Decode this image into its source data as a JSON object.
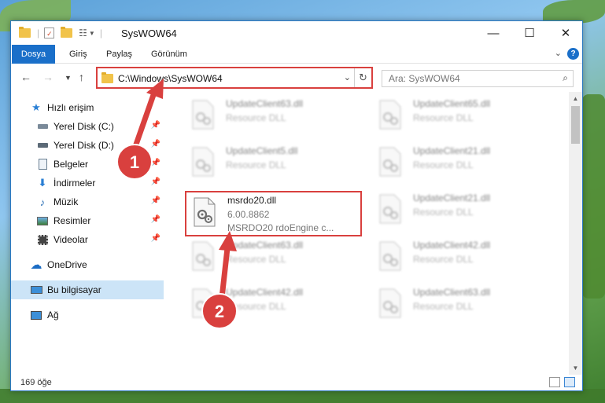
{
  "window": {
    "title": "SysWOW64"
  },
  "ribbon": {
    "tabs": [
      "Dosya",
      "Giriş",
      "Paylaş",
      "Görünüm"
    ],
    "help": "?"
  },
  "nav": {
    "address_path": "C:\\Windows\\SysWOW64",
    "search_placeholder": "Ara: SysWOW64"
  },
  "sidebar": {
    "items": [
      {
        "label": "Hızlı erişim",
        "icon": "star-icon"
      },
      {
        "label": "Yerel Disk (C:)",
        "icon": "drive-icon",
        "pinned": true
      },
      {
        "label": "Yerel Disk (D:)",
        "icon": "drive-icon",
        "pinned": true
      },
      {
        "label": "Belgeler",
        "icon": "documents-icon",
        "pinned": true
      },
      {
        "label": "İndirmeler",
        "icon": "download-icon",
        "pinned": true
      },
      {
        "label": "Müzik",
        "icon": "music-icon",
        "pinned": true
      },
      {
        "label": "Resimler",
        "icon": "pictures-icon",
        "pinned": true
      },
      {
        "label": "Videolar",
        "icon": "videos-icon",
        "pinned": true
      },
      {
        "label": "OneDrive",
        "icon": "onedrive-icon"
      },
      {
        "label": "Bu bilgisayar",
        "icon": "computer-icon",
        "selected": true
      },
      {
        "label": "Ağ",
        "icon": "network-icon"
      }
    ]
  },
  "files": {
    "blurred": [
      {
        "name": "UpdateClient63.dll",
        "type": "Resource DLL"
      },
      {
        "name": "UpdateClient65.dll",
        "type": "Resource DLL"
      },
      {
        "name": "UpdateClient5.dll",
        "type": "Resource DLL"
      },
      {
        "name": "UpdateClient21.dll",
        "type": "Resource DLL"
      },
      {
        "name": "UpdateClient21.dll",
        "type": "Resource DLL"
      },
      {
        "name": "UpdateClient63.dll",
        "type": "Resource DLL"
      },
      {
        "name": "UpdateClient42.dll",
        "type": "Resource DLL"
      },
      {
        "name": "UpdateClient42.dll",
        "type": "Resource DLL"
      },
      {
        "name": "UpdateClient63.dll",
        "type": "Resource DLL"
      }
    ],
    "target": {
      "name": "msrdo20.dll",
      "version": "6.00.8862",
      "description": "MSRDO20 rdoEngine c..."
    }
  },
  "status": {
    "item_count": "169 öğe"
  },
  "annotations": {
    "step1": "1",
    "step2": "2",
    "color": "#d9403e"
  }
}
